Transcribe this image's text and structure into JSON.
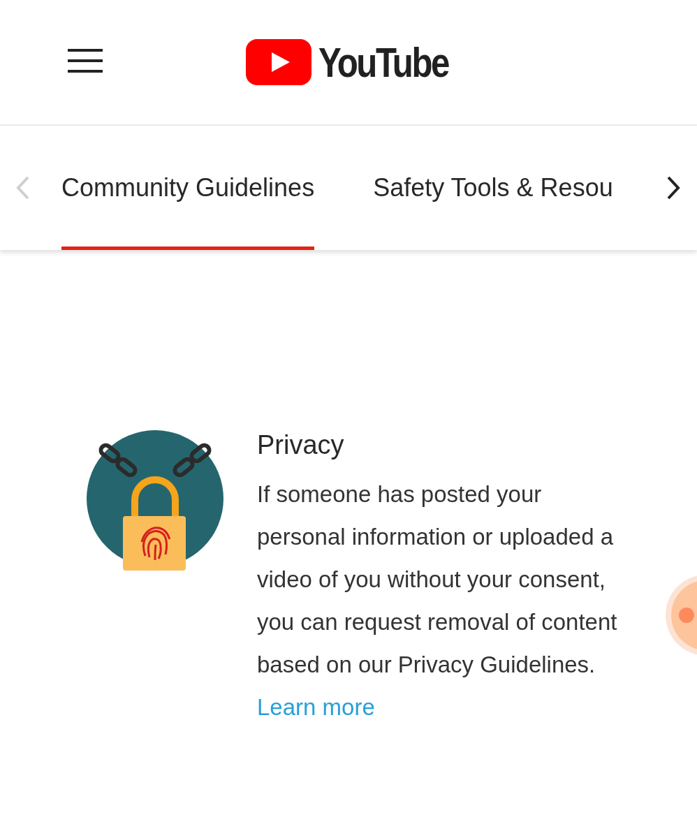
{
  "header": {
    "logo_text": "YouTube"
  },
  "tabs": {
    "prev_disabled": true,
    "next_disabled": false,
    "items": [
      {
        "label": "Community Guidelines",
        "selected": true
      },
      {
        "label": "Safety Tools & Resou",
        "selected": false
      }
    ]
  },
  "section": {
    "title": "Privacy",
    "body": "If someone has posted your personal information or uploaded a video of you without your consent, you can request removal of content based on our Privacy Guidelines.",
    "link": "Learn more"
  }
}
